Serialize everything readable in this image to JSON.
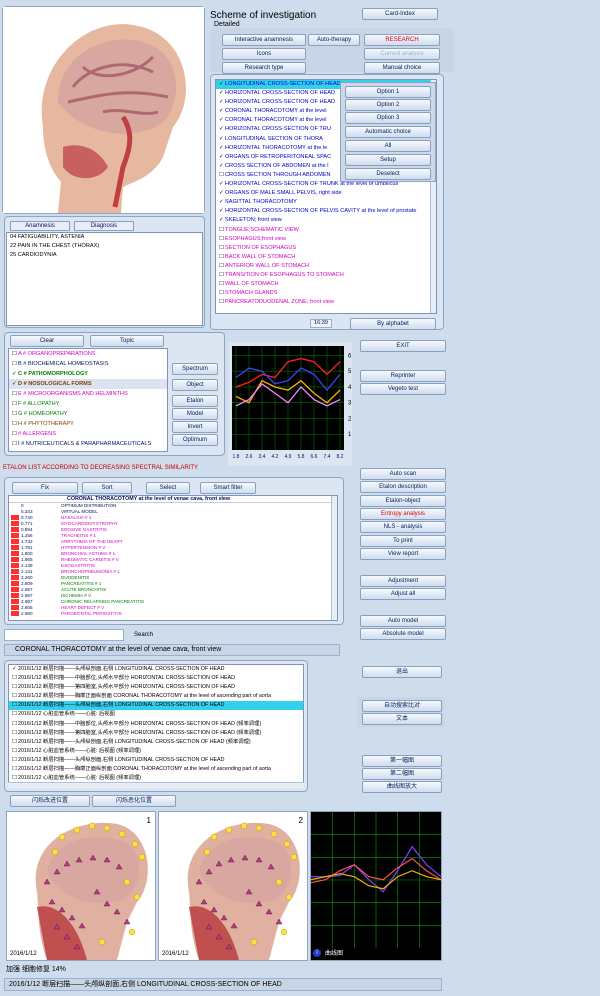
{
  "title": "Scheme of investigation",
  "subtitle": "Detailed",
  "top_buttons": {
    "card_index": "Card-Index",
    "interactive": "Interactive anamnesis",
    "auto_therapy": "Auto-therapy",
    "research": "RESEARCH",
    "icons": "Icons",
    "current_analysis": "Current analysis",
    "research_type": "Research type",
    "manual_choice": "Manual choice"
  },
  "exam_list": [
    {
      "c": "✓",
      "t": "LONGITUDINAL CROSS-SECTION OF HEAD",
      "k": "sel"
    },
    {
      "c": "✓",
      "t": "HORIZONTAL CROSS-SECTION OF HEAD",
      "k": "blue"
    },
    {
      "c": "✓",
      "t": "HORIZONTAL CROSS-SECTION OF HEAD",
      "k": "blue"
    },
    {
      "c": "✓",
      "t": "CORONAL THORACOTOMY at the level",
      "k": "blue"
    },
    {
      "c": "✓",
      "t": "CORONAL THORACOTOMY at the level",
      "k": "blue"
    },
    {
      "c": "✓",
      "t": "HORIZONTAL CROSS-SECTION OF TRU",
      "k": "blue"
    },
    {
      "c": "✓",
      "t": "LONGITUDINAL SECTION OF THORA",
      "k": "blue"
    },
    {
      "c": "✓",
      "t": "HORIZONTAL THORACOTOMY at the le",
      "k": "blue"
    },
    {
      "c": "✓",
      "t": "ORGANS OF RETROPERITONEAL SPAC",
      "k": "blue"
    },
    {
      "c": "✓",
      "t": "CROSS SECTION OF ABDOMEN at the l",
      "k": "blue"
    },
    {
      "c": "☐",
      "t": "CROSS SECTION THROUGH ABDOMEN",
      "k": "blue"
    },
    {
      "c": "✓",
      "t": "HORIZONTAL CROSS-SECTION OF TRUNK at the level of umbilicus",
      "k": "blue"
    },
    {
      "c": "✓",
      "t": "ORGANS OF MALE SMALL PELVIS, right side",
      "k": "blue"
    },
    {
      "c": "✓",
      "t": "SAGITTAL THORACOTOMY",
      "k": "blue"
    },
    {
      "c": "✓",
      "t": "HORIZONTAL CROSS-SECTION OF PELVIS CAVITY at the level of prostate",
      "k": "blue"
    },
    {
      "c": "✓",
      "t": "SKELETON;  front  view",
      "k": "blue"
    },
    {
      "c": "☐",
      "t": "TONGUE;SCHEMATIC VIEW",
      "k": "pink"
    },
    {
      "c": "☐",
      "t": "ESOPHAGUS;front view",
      "k": "pink"
    },
    {
      "c": "☐",
      "t": "SECTION OF ESOPHAGUS",
      "k": "pink"
    },
    {
      "c": "☐",
      "t": "BACK WALL OF STOMACH",
      "k": "pink"
    },
    {
      "c": "☐",
      "t": "ANTERIOR  WALL  OF  STOMACH",
      "k": "pink"
    },
    {
      "c": "☐",
      "t": "TRANSITION OF ESOPHAGUS TO STOMACH",
      "k": "pink"
    },
    {
      "c": "☐",
      "t": "WALL OF STOMACH",
      "k": "pink"
    },
    {
      "c": "☐",
      "t": "STOMACH  GLANDS",
      "k": "pink"
    },
    {
      "c": "☐",
      "t": "PANCREATODUODENAL  ZONE;  front  view",
      "k": "pink"
    }
  ],
  "popup": {
    "option1": "Option 1",
    "option2": "Option 2",
    "option3": "Option 3",
    "auto": "Automatic choice",
    "all": "All",
    "setup": "Setup",
    "deselect": "Deselect"
  },
  "list_time": "16:39",
  "by_alphabet": "By alphabet",
  "anamnesis_tab": "Anamnesis",
  "diagnosis_tab": "Diagnosis",
  "diagnosis": [
    "04  FATIGUABILITY, ASTENIA",
    "22  PAIN  IN  THE  CHEST (THORAX)",
    "25  CARDIODYNIA"
  ],
  "clear_btn": "Clear",
  "topic_btn": "Topic",
  "categories": [
    {
      "c": "☐",
      "t": "A # ORGANOPREPARATIONS",
      "col": "#d000c0",
      "b": false
    },
    {
      "c": "☐",
      "t": "B # BIOCHEMICAL HOMEOSTASIS",
      "col": "#001060",
      "b": false
    },
    {
      "c": "✓",
      "t": "C # PATHOMORPHOLOGY",
      "col": "#008000",
      "b": true
    },
    {
      "c": "✓",
      "t": "D # NOSOLOGICAL  FORMS",
      "col": "#804000",
      "b": true
    },
    {
      "c": "☐",
      "t": "E # MICROORGANISMS AND HELMINTHS",
      "col": "#d000c0",
      "b": false
    },
    {
      "c": "☐",
      "t": "F # ALLOPATHY",
      "col": "#008000",
      "b": false
    },
    {
      "c": "☐",
      "t": "G # HOMEOPATHY",
      "col": "#008000",
      "b": false
    },
    {
      "c": "☐",
      "t": "H # PHYTOTHERAPY",
      "col": "#804000",
      "b": false
    },
    {
      "c": "☐",
      "t": "# ALLERGENS",
      "col": "#d000c0",
      "b": false
    },
    {
      "c": "☐",
      "t": "I # NUTRICEUTICALS & PARAPHARMACEUTICALS",
      "col": "#001060",
      "b": false
    }
  ],
  "side_buttons": {
    "spectrum": "Spectrum",
    "object": "Object",
    "etalon": "Etalon",
    "model": "Model",
    "invert": "Invert",
    "optimum": "Optimum"
  },
  "chart_data": {
    "type": "line",
    "x": [
      1.8,
      2.6,
      3.4,
      4.2,
      4.9,
      5.8,
      6.6,
      7.4,
      8.2
    ],
    "x_ticks": [
      "1.8",
      "2.6",
      "3.4",
      "4.2",
      "4.9",
      "5.8",
      "6.6",
      "7.4",
      "8.2"
    ],
    "y_ticks": [
      "1",
      "2",
      "3",
      "4",
      "5",
      "6"
    ],
    "ylim": [
      0,
      6.6
    ],
    "grid": true,
    "series": [
      {
        "color": "#ff2020",
        "values": [
          4.0,
          4.3,
          4.8,
          4.6,
          5.6,
          5.8,
          5.6,
          4.8,
          5.6
        ]
      },
      {
        "color": "#4040ff",
        "values": [
          4.6,
          5.2,
          5.0,
          4.2,
          4.4,
          5.2,
          4.8,
          3.8,
          4.8
        ]
      },
      {
        "color": "#ffb000",
        "values": [
          3.4,
          3.0,
          4.4,
          4.0,
          3.8,
          4.4,
          3.6,
          3.0,
          3.8
        ]
      },
      {
        "color": "#ff80ff",
        "values": [
          2.8,
          3.2,
          4.2,
          3.6,
          3.0,
          4.0,
          3.2,
          2.8,
          3.2
        ]
      }
    ]
  },
  "right_buttons": {
    "exit": "EXIT",
    "reprinter": "Reprinter",
    "vegeto": "Vegeto test",
    "auto_scan": "Auto scan",
    "etalon_desc": "Etalon description",
    "etalon_obj": "Etalon-object",
    "entropy": "Entropy analysis",
    "nls": "NLS - analysis",
    "to_print": "To print",
    "view_report": "View report",
    "adjustment": "Adjustment",
    "adjust_all": "Adjust all",
    "auto_model": "Auto model",
    "absolute_model": "Absolute model"
  },
  "etalon_title": "ETALON LIST ACCORDING TO DECREASING SPECTRAL SIMILARITY",
  "etalon_tabs": {
    "fix": "Fix",
    "sort": "Sort",
    "select": "Select",
    "smart_filter": "Smart filter"
  },
  "etalon_header": "CORONAL THORACOTOMY at the level of venae cava, front view",
  "etalon_rows": [
    {
      "v": "0",
      "t": "OPTIMUM DISTRIBUTION",
      "c": "#001060",
      "m": ""
    },
    {
      "v": "5.343",
      "t": "VIRTUAL MODEL",
      "c": "#001060",
      "m": ""
    },
    {
      "v": "0.740",
      "t": "NASALGIA # 1",
      "c": "#d000c0",
      "m": "#ff3030"
    },
    {
      "v": "0.771",
      "t": "MYOCARDIODYSTROPHY",
      "c": "#d000c0",
      "m": "#ff3030"
    },
    {
      "v": "0.894",
      "t": "EROSIVE GASTRITIS",
      "c": "#d000c0",
      "m": "#ff3030"
    },
    {
      "v": "1.256",
      "t": "TRACHEITIS # 1",
      "c": "#d000c0",
      "m": "#ff3030"
    },
    {
      "v": "1.732",
      "t": "ARRYTHMIA  OF  THE  HEART",
      "c": "#d000c0",
      "m": "#ff3030"
    },
    {
      "v": "1.781",
      "t": "HYPERTENSION # V",
      "c": "#d000c0",
      "m": "#ff3030"
    },
    {
      "v": "1.800",
      "t": "BRONCHIAL  ASTHMA  # 1",
      "c": "#d000c0",
      "m": "#ff3030"
    },
    {
      "v": "1.865",
      "t": "RHEUMATIC  CARDITIS # V",
      "c": "#d000c0",
      "m": "#ff3030"
    },
    {
      "v": "2.138",
      "t": "ESOGASTRITIS",
      "c": "#d000c0",
      "m": "#ff3030"
    },
    {
      "v": "2.141",
      "t": "BRONCHOPNEUMONIA # 1",
      "c": "#d000c0",
      "m": "#ff3030"
    },
    {
      "v": "2.260",
      "t": "DUODENITIS",
      "c": "#008000",
      "m": "#ff3030"
    },
    {
      "v": "2.609",
      "t": "PANCREATITIS # 1",
      "c": "#008000",
      "m": "#ff3030"
    },
    {
      "v": "2.657",
      "t": "ACUTE  BRONCHITIS",
      "c": "#008000",
      "m": "#ff3030"
    },
    {
      "v": "2.697",
      "t": "ISCHEMIA  # V",
      "c": "#008000",
      "m": "#ff3030"
    },
    {
      "v": "2.897",
      "t": "CHRONIC  RELAPSING  PANCREATITIS",
      "c": "#008000",
      "m": "#ff3030"
    },
    {
      "v": "2.805",
      "t": "HEART DEFECT # V",
      "c": "#d000c0",
      "m": "#ff3030"
    },
    {
      "v": "2.990",
      "t": "PARODONTAL  PERIOSTITIS",
      "c": "#d000c0",
      "m": "#ff3030"
    }
  ],
  "search_label": "Search",
  "status_title": "CORONAL THORACOTOMY at the level of venae cava, front view",
  "history": [
    {
      "c": "✓",
      "t": "2016/1/12  断层扫描——头颅纵剖面,右侧 LONGITUDINAL CROSS-SECTION OF HEAD",
      "s": false
    },
    {
      "c": "☐",
      "t": "2016/1/12  断层扫描——中脑部位,头颅水平部分 HORIZONTAL CROSS-SECTION OF HEAD",
      "s": false
    },
    {
      "c": "☐",
      "t": "2016/1/12  断层扫描——第四脑室,头颅水平部分 HORIZONTAL CROSS-SECTION OF HEAD",
      "s": false
    },
    {
      "c": "☐",
      "t": "2016/1/12  断层扫描——胸廓正面纵剖面 CORONAL THORACOTOMY at the level of ascending part of aorta",
      "s": false
    },
    {
      "c": "☐",
      "t": "2016/1/12  断层扫描——头颅纵剖面,右侧 LONGITUDINAL CROSS-SECTION OF HEAD",
      "s": true
    },
    {
      "c": "☐",
      "t": "2016/1/12  心脏血管系统——心脏: 后视图",
      "s": false
    },
    {
      "c": "☐",
      "t": "2016/1/12  断层扫描——中脑部位,头颅水平部分 HORIZONTAL CROSS-SECTION OF HEAD  (频率调理)",
      "s": false
    },
    {
      "c": "☐",
      "t": "2016/1/12  断层扫描——第四脑室,头颅水平部分 HORIZONTAL CROSS-SECTION OF HEAD  (频率调理)",
      "s": false
    },
    {
      "c": "☐",
      "t": "2016/1/12  断层扫描——头颅纵剖面,右侧 LONGITUDINAL CROSS-SECTION OF HEAD  (频率调理)",
      "s": false
    },
    {
      "c": "☐",
      "t": "2016/1/12  心脏血管系统——心脏: 后视图  (频率调理)",
      "s": false
    },
    {
      "c": "☐",
      "t": "2016/1/12  断层扫描——头颅纵剖面,右侧 LONGITUDINAL CROSS-SECTION OF HEAD",
      "s": false
    },
    {
      "c": "☐",
      "t": "2016/1/12  断层扫描——胸廓正面纵剖面 CORONAL THORACOTOMY at the level of ascending part of aorta",
      "s": false
    },
    {
      "c": "☐",
      "t": "2016/1/12  心脏血管系统——心脏: 后视图  (频率调理)",
      "s": false
    }
  ],
  "cn_buttons": {
    "exit": "退出",
    "compare": "自动搜索比对",
    "text": "文本",
    "first": "第一幅图",
    "second": "第二幅图",
    "curve": "曲线图放大"
  },
  "flash": {
    "a": "闪烁改进位置",
    "b": "闪烁恶化位置"
  },
  "thumbs": {
    "n1": "1",
    "n2": "2",
    "date1": "2016/1/12",
    "date2": "2016/1/12"
  },
  "curve_label": "曲线图",
  "restore": "加强  细胞修复  14%",
  "status_bottom": "2016/1/12 断层扫描——头颅纵剖面,右侧 LONGITUDINAL CROSS-SECTION OF HEAD",
  "chart2_data": {
    "type": "line",
    "series": [
      {
        "color": "#8040ff",
        "values": [
          0.1,
          0.1,
          0.12,
          0.3,
          0.05,
          -0.15,
          0.2,
          0.6,
          0.3,
          0.1
        ]
      },
      {
        "color": "#ff5050",
        "values": [
          0.0,
          0.05,
          0.2,
          0.3,
          0.1,
          0.05,
          0.25,
          0.4,
          0.2,
          0.05
        ]
      },
      {
        "color": "#ffb000",
        "values": [
          0.05,
          0.1,
          0.15,
          0.1,
          -0.05,
          -0.1,
          0.1,
          0.2,
          0.1,
          0.05
        ]
      }
    ]
  }
}
